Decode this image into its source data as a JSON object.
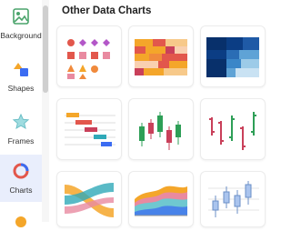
{
  "sidebar": {
    "items": [
      {
        "label": "Background",
        "icon": "image-icon"
      },
      {
        "label": "Shapes",
        "icon": "shapes-icon"
      },
      {
        "label": "Frames",
        "icon": "star-icon"
      },
      {
        "label": "Charts",
        "icon": "chart-icon"
      },
      {
        "label": "",
        "icon": "more-icon"
      }
    ],
    "active_index": 3
  },
  "section": {
    "title": "Other Data Charts"
  },
  "charts": [
    {
      "name": "shape-grid-chart"
    },
    {
      "name": "heatmap-warm-chart"
    },
    {
      "name": "heatmap-blue-chart"
    },
    {
      "name": "gantt-chart"
    },
    {
      "name": "candlestick-chart"
    },
    {
      "name": "ohlc-chart"
    },
    {
      "name": "sankey-chart"
    },
    {
      "name": "streamgraph-chart"
    },
    {
      "name": "boxplot-chart"
    }
  ],
  "colors": {
    "accent": "#3b6cf2",
    "active_bg": "#e9eefc"
  }
}
